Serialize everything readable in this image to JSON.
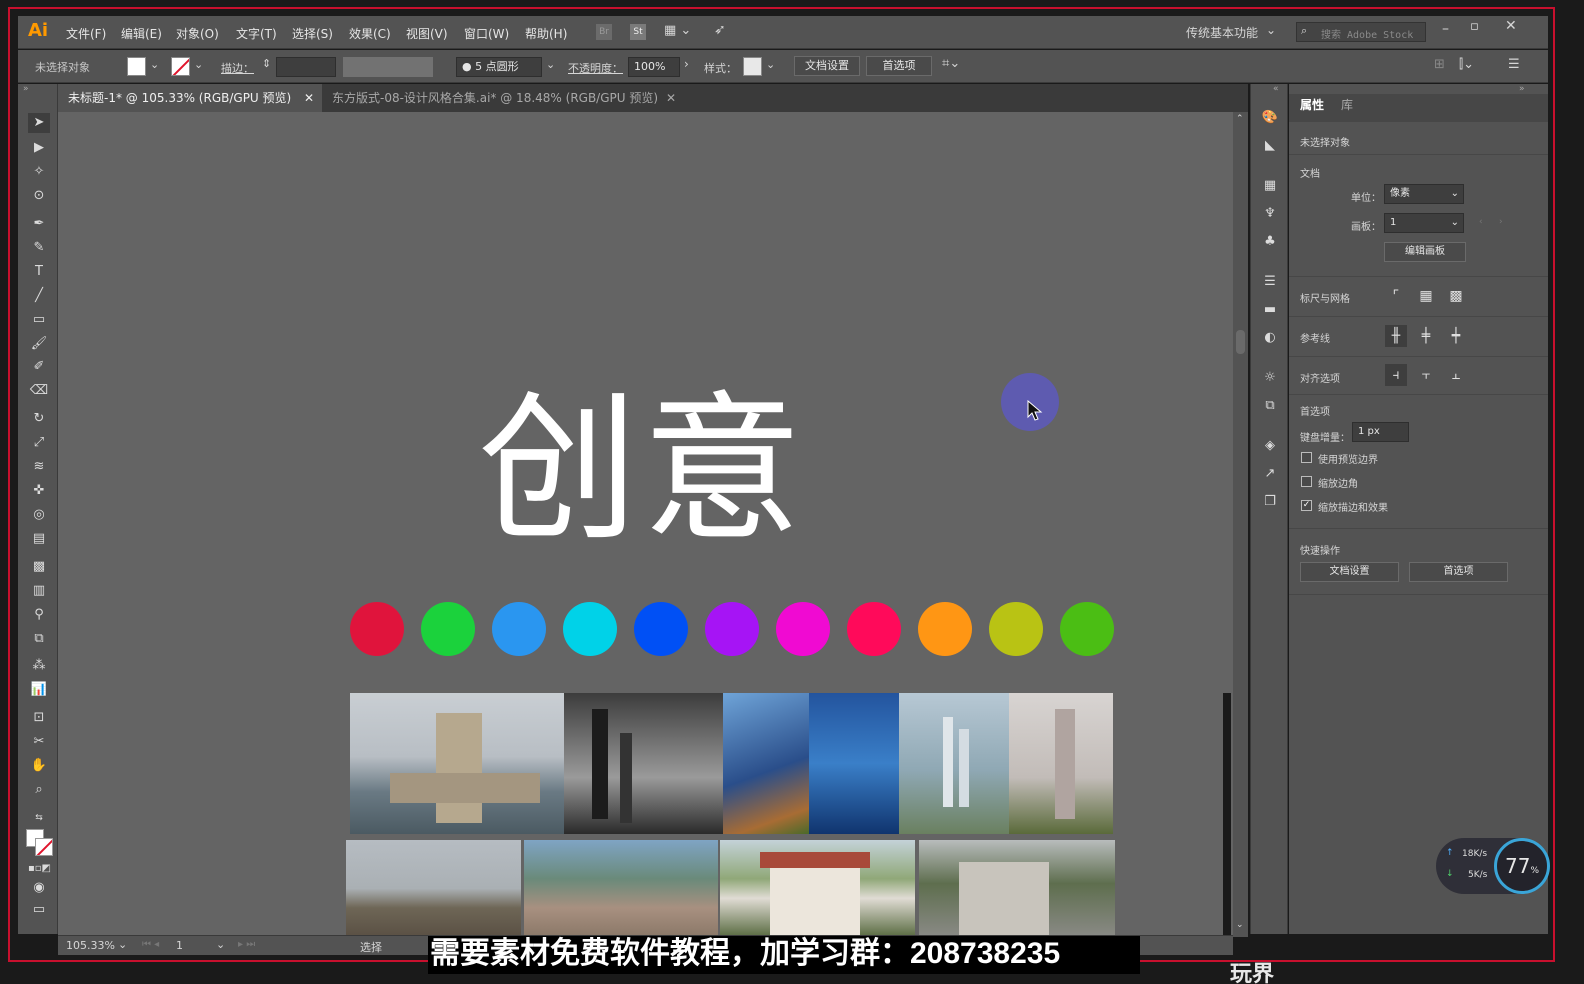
{
  "app": {
    "logo": "Ai"
  },
  "menu": [
    "文件(F)",
    "编辑(E)",
    "对象(O)",
    "文字(T)",
    "选择(S)",
    "效果(C)",
    "视图(V)",
    "窗口(W)",
    "帮助(H)"
  ],
  "workspace": {
    "label": "传统基本功能",
    "search_placeholder": "搜索 Adobe Stock"
  },
  "control": {
    "no_selection": "未选择对象",
    "stroke_label": "描边：",
    "brush": "5 点圆形",
    "opacity_label": "不透明度：",
    "opacity_value": "100%",
    "style_label": "样式：",
    "doc_setup": "文档设置",
    "prefs": "首选项"
  },
  "tabs": [
    {
      "label": "未标题-1* @ 105.33% (RGB/GPU 预览)"
    },
    {
      "label": "东方版式-08-设计风格合集.ai* @ 18.48% (RGB/GPU 预览)"
    }
  ],
  "canvas": {
    "title": "创意"
  },
  "colors": [
    "#e0143c",
    "#1bd23c",
    "#2a96f0",
    "#00d2e8",
    "#0050f5",
    "#a614f5",
    "#f00ad2",
    "#ff0a5a",
    "#ff9614",
    "#b9c314",
    "#4bbe14"
  ],
  "panel": {
    "tab_props": "属性",
    "tab_lib": "库",
    "no_selection": "未选择对象",
    "doc_section": "文档",
    "unit_label": "单位：",
    "unit_value": "像素",
    "artboard_label": "画板：",
    "artboard_value": "1",
    "edit_artboard": "编辑画板",
    "rulers_grids": "标尺与网格",
    "guides": "参考线",
    "align_options": "对齐选项",
    "preferences": "首选项",
    "keyboard_inc_label": "键盘增量：",
    "keyboard_inc_value": "1 px",
    "use_preview_bounds": "使用预览边界",
    "scale_corners": "缩放边角",
    "scale_strokes": "缩放描边和效果",
    "quick_actions": "快速操作",
    "qa_doc_setup": "文档设置",
    "qa_prefs": "首选项"
  },
  "status": {
    "zoom": "105.33%",
    "artboard": "1",
    "tool": "选择"
  },
  "caption": "需要素材免费软件教程，加学习群：208738235",
  "bottom_right_text": "玩界",
  "network": {
    "up": "18K/s",
    "down": "5K/s",
    "gauge": "77"
  }
}
